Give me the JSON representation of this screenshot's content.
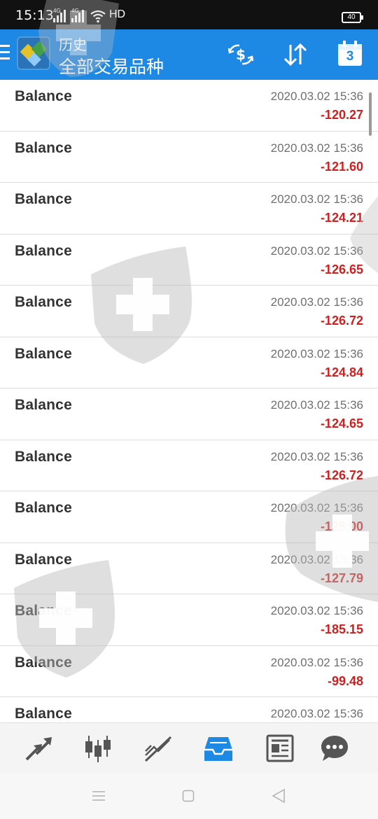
{
  "status_bar": {
    "time": "15:13",
    "network1": "4G",
    "network2": "4G",
    "hd_label": "HD",
    "battery": "40"
  },
  "app_bar": {
    "title": "历史",
    "subtitle": "全部交易品种",
    "calendar_day": "3",
    "icons": [
      "menu-icon",
      "app-logo",
      "currency-exchange-icon",
      "sort-icon",
      "calendar-icon"
    ]
  },
  "history": {
    "rows": [
      {
        "label": "Balance",
        "date": "2020.03.02 15:36",
        "amount": "-120.27"
      },
      {
        "label": "Balance",
        "date": "2020.03.02 15:36",
        "amount": "-121.60"
      },
      {
        "label": "Balance",
        "date": "2020.03.02 15:36",
        "amount": "-124.21"
      },
      {
        "label": "Balance",
        "date": "2020.03.02 15:36",
        "amount": "-126.65"
      },
      {
        "label": "Balance",
        "date": "2020.03.02 15:36",
        "amount": "-126.72"
      },
      {
        "label": "Balance",
        "date": "2020.03.02 15:36",
        "amount": "-124.84"
      },
      {
        "label": "Balance",
        "date": "2020.03.02 15:36",
        "amount": "-124.65"
      },
      {
        "label": "Balance",
        "date": "2020.03.02 15:36",
        "amount": "-126.72"
      },
      {
        "label": "Balance",
        "date": "2020.03.02 15:36",
        "amount": "-128.00"
      },
      {
        "label": "Balance",
        "date": "2020.03.02 15:36",
        "amount": "-127.79"
      },
      {
        "label": "Balance",
        "date": "2020.03.02 15:36",
        "amount": "-185.15"
      },
      {
        "label": "Balance",
        "date": "2020.03.02 15:36",
        "amount": "-99.48"
      },
      {
        "label": "Balance",
        "date": "2020.03.02 15:36",
        "amount": ""
      }
    ]
  },
  "bottom_nav": {
    "items": [
      "quotes-icon",
      "chart-icon",
      "trade-icon",
      "history-icon",
      "news-icon",
      "chat-icon"
    ],
    "active": "history-icon"
  },
  "colors": {
    "app_bar": "#1e88e5",
    "amount_negative": "#d01f1f",
    "active_tab": "#1e88e5",
    "inactive_tab": "#555555"
  }
}
